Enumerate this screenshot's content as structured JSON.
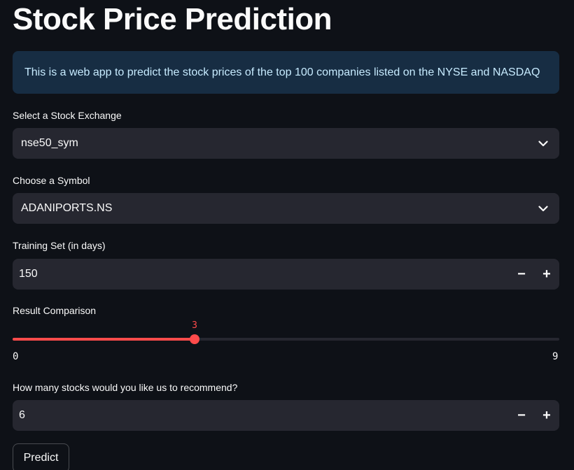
{
  "title": "Stock Price Prediction",
  "info": "This is a web app to predict the stock prices of the top 100 companies listed on the NYSE and NASDAQ",
  "exchange": {
    "label": "Select a Stock Exchange",
    "value": "nse50_sym",
    "icon": "chevron-down-icon"
  },
  "symbol": {
    "label": "Choose a Symbol",
    "value": "ADANIPORTS.NS",
    "icon": "chevron-down-icon"
  },
  "training": {
    "label": "Training Set (in days)",
    "value": "150",
    "minus": "−",
    "plus": "+"
  },
  "comparison": {
    "label": "Result Comparison",
    "value": "3",
    "min": "0",
    "max": "9",
    "level": 0.3333
  },
  "recommend": {
    "label": "How many stocks would you like us to recommend?",
    "value": "6",
    "minus": "−",
    "plus": "+"
  },
  "predict_label": "Predict",
  "colors": {
    "background": "#0e1117",
    "info_bg": "#172d43",
    "info_text": "#c7ebff",
    "input_bg": "#262730",
    "accent": "#ff4b4b"
  }
}
